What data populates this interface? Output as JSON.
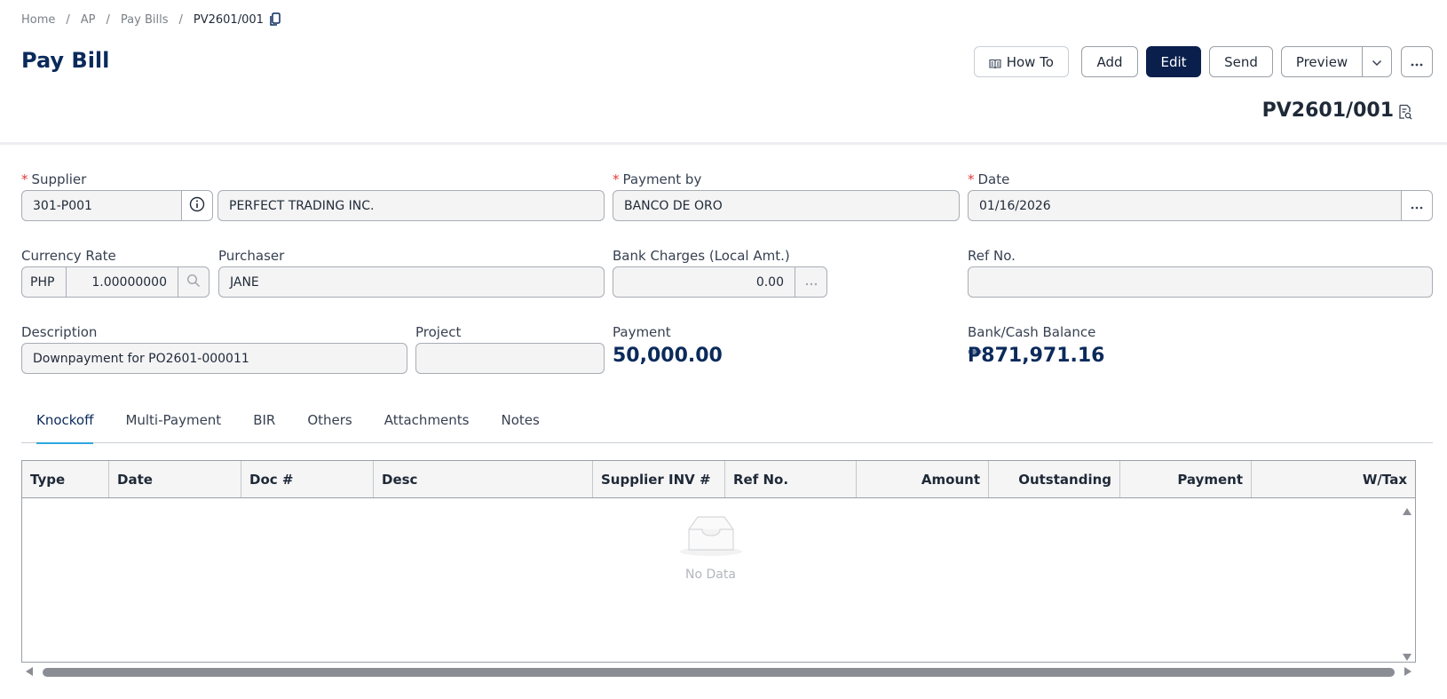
{
  "breadcrumb": {
    "items": [
      "Home",
      "AP",
      "Pay Bills"
    ],
    "current": "PV2601/001",
    "separator": "/"
  },
  "page_title": "Pay Bill",
  "toolbar": {
    "how_to": "How To",
    "add": "Add",
    "edit": "Edit",
    "send": "Send",
    "preview": "Preview"
  },
  "doc_number": "PV2601/001",
  "form": {
    "supplier": {
      "label": "Supplier",
      "code": "301-P001",
      "name": "PERFECT TRADING INC."
    },
    "payment_by": {
      "label": "Payment by",
      "value": "BANCO DE ORO"
    },
    "date": {
      "label": "Date",
      "value": "01/16/2026"
    },
    "currency_rate": {
      "label": "Currency Rate",
      "currency": "PHP",
      "rate": "1.00000000"
    },
    "purchaser": {
      "label": "Purchaser",
      "value": "JANE"
    },
    "bank_charges": {
      "label": "Bank Charges (Local Amt.)",
      "value": "0.00"
    },
    "ref_no": {
      "label": "Ref No.",
      "value": ""
    },
    "description": {
      "label": "Description",
      "value": "Downpayment for PO2601-000011"
    },
    "project": {
      "label": "Project",
      "value": ""
    },
    "payment": {
      "label": "Payment",
      "value": "50,000.00"
    },
    "bank_balance": {
      "label": "Bank/Cash Balance",
      "value": "₱871,971.16"
    }
  },
  "tabs": [
    "Knockoff",
    "Multi-Payment",
    "BIR",
    "Others",
    "Attachments",
    "Notes"
  ],
  "active_tab": "Knockoff",
  "grid": {
    "columns": [
      "Type",
      "Date",
      "Doc #",
      "Desc",
      "Supplier INV #",
      "Ref No.",
      "Amount",
      "Outstanding",
      "Payment",
      "W/Tax"
    ],
    "rows": [],
    "empty_text": "No Data"
  },
  "colors": {
    "primary": "#0b1f4d",
    "title": "#0b2a5b",
    "tab_indicator": "#2fa7e0",
    "required": "#e23a3a"
  },
  "icons": [
    "copy-icon",
    "book-icon",
    "chevron-down-icon",
    "ellipsis-icon",
    "document-search-icon",
    "info-icon",
    "search-icon",
    "empty-inbox-icon"
  ]
}
